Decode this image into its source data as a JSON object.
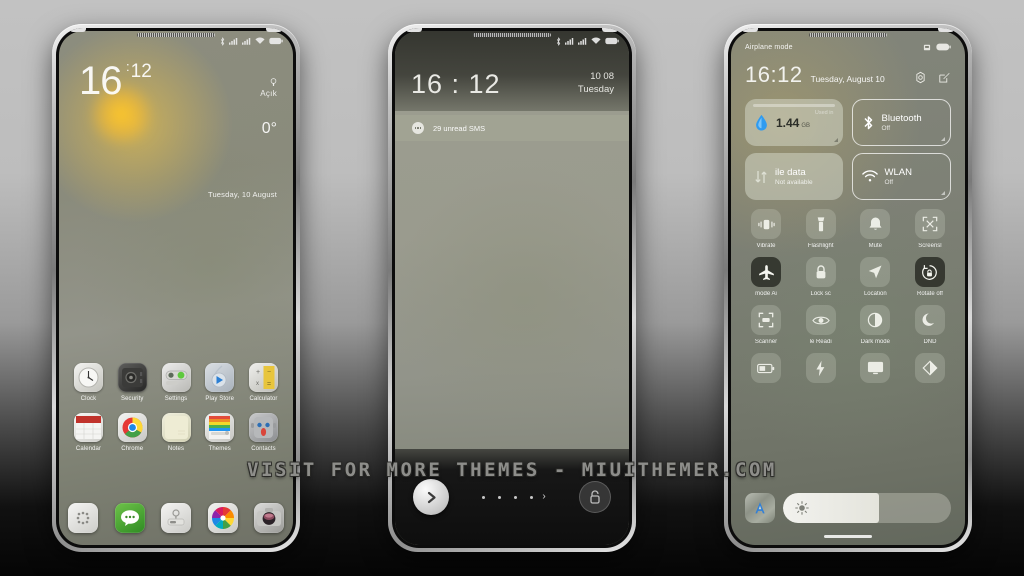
{
  "watermark": "VISIT FOR MORE THEMES - MIUITHEMER.COM",
  "phone1": {
    "name": "home-screen",
    "statusbar": {
      "icons": [
        "bluetooth-icon",
        "signal-icon",
        "signal-icon",
        "wifi-icon",
        "battery-icon"
      ]
    },
    "clock": {
      "hour": "16",
      "minute": "12"
    },
    "weather": {
      "condition": "Açık",
      "temperature": "0°",
      "icon": "sun-icon"
    },
    "date": "Tuesday, 10 August",
    "apps_row1": [
      {
        "label": "Clock",
        "icon": "clock-app-icon"
      },
      {
        "label": "Security",
        "icon": "security-app-icon"
      },
      {
        "label": "Settings",
        "icon": "settings-app-icon"
      },
      {
        "label": "Play Store",
        "icon": "play-store-app-icon"
      },
      {
        "label": "Calculator",
        "icon": "calculator-app-icon"
      }
    ],
    "apps_row2": [
      {
        "label": "Calendar",
        "icon": "calendar-app-icon"
      },
      {
        "label": "Chrome",
        "icon": "chrome-app-icon"
      },
      {
        "label": "Notes",
        "icon": "notes-app-icon"
      },
      {
        "label": "Themes",
        "icon": "themes-app-icon"
      },
      {
        "label": "Contacts",
        "icon": "contacts-app-icon"
      }
    ],
    "dock": [
      {
        "icon": "dialer-app-icon"
      },
      {
        "icon": "messages-app-icon"
      },
      {
        "icon": "browser-app-icon"
      },
      {
        "icon": "gallery-app-icon"
      },
      {
        "icon": "camera-app-icon"
      }
    ]
  },
  "phone2": {
    "name": "lock-screen",
    "statusbar": {
      "icons": [
        "bluetooth-icon",
        "signal-icon",
        "signal-icon",
        "wifi-icon",
        "battery-icon"
      ]
    },
    "time": "16 : 12",
    "date_day": "10 08",
    "date_weekday": "Tuesday",
    "notification": {
      "icon": "sms-icon",
      "text": "29 unread SMS"
    },
    "unlock": {
      "arrow_icon": "chevron-right-icon",
      "lock_icon": "lock-icon",
      "dots": 4,
      "chevron": "›"
    }
  },
  "phone3": {
    "name": "control-center",
    "status_left": "Airplane mode",
    "status_icons": [
      "sim-icon",
      "battery-icon"
    ],
    "time": "16:12",
    "date": "Tuesday, August 10",
    "header_icons": [
      "gear-icon",
      "edit-icon"
    ],
    "big_tiles_row1": [
      {
        "title": "1.44",
        "unit": "GB",
        "sub": "Used in",
        "icon": "data-drop-icon",
        "state": "filled"
      },
      {
        "title": "Bluetooth",
        "sub": "Off",
        "icon": "bluetooth-icon",
        "state": "outlined"
      }
    ],
    "big_tiles_row2": [
      {
        "title": "ile data",
        "sub": "Not available",
        "icon": "mobile-data-icon",
        "state": "filled"
      },
      {
        "title": "WLAN",
        "sub": "Off",
        "icon": "wifi-icon",
        "state": "outlined"
      }
    ],
    "toggles_row1": [
      {
        "label": "Vibrate",
        "icon": "vibrate-icon",
        "on": false
      },
      {
        "label": "Flashlight",
        "icon": "flashlight-icon",
        "on": false
      },
      {
        "label": "Mute",
        "icon": "bell-icon",
        "on": false
      },
      {
        "label": "Screensl",
        "icon": "screenshot-icon",
        "on": false
      }
    ],
    "toggles_row2": [
      {
        "label": "mode  Ai",
        "icon": "airplane-icon",
        "on": true
      },
      {
        "label": "Lock sc",
        "icon": "lock-icon",
        "on": false
      },
      {
        "label": "Location",
        "icon": "location-icon",
        "on": false
      },
      {
        "label": "Rotate off",
        "icon": "rotate-lock-icon",
        "on": true
      }
    ],
    "toggles_row3": [
      {
        "label": "Scanner",
        "icon": "scanner-icon",
        "on": false
      },
      {
        "label": "le  Readi",
        "icon": "eye-icon",
        "on": false
      },
      {
        "label": "Dark mode",
        "icon": "contrast-icon",
        "on": false
      },
      {
        "label": "DND",
        "icon": "moon-icon",
        "on": false
      }
    ],
    "toggles_row4": [
      {
        "label": "",
        "icon": "battery-saver-icon",
        "on": false
      },
      {
        "label": "",
        "icon": "lightning-icon",
        "on": false
      },
      {
        "label": "",
        "icon": "cast-icon",
        "on": false
      },
      {
        "label": "",
        "icon": "color-mode-icon",
        "on": false
      }
    ],
    "brightness": {
      "icon": "brightness-icon",
      "value": 57,
      "auto_icon": "auto-brightness-icon"
    }
  }
}
